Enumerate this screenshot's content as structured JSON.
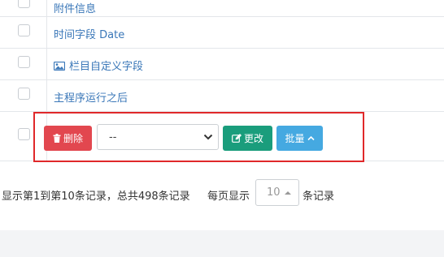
{
  "table": {
    "rows": [
      {
        "label": "附件信息"
      },
      {
        "label": "时间字段 Date"
      },
      {
        "label": "栏目自定义字段",
        "icon": "image-icon"
      },
      {
        "label": "主程序运行之后"
      }
    ]
  },
  "toolbar": {
    "delete_label": "删除",
    "delete_icon": "trash-icon",
    "select_value": "--",
    "update_label": "更改",
    "update_icon": "edit-icon",
    "batch_label": "批量",
    "batch_icon": "chevron-up-icon",
    "colors": {
      "delete": "#e2474f",
      "update": "#1a9d7c",
      "batch": "#45a9e1",
      "highlight": "#e0282a"
    }
  },
  "pagination": {
    "summary": "显示第1到第10条记录，总共498条记录",
    "per_page_prefix": "每页显示",
    "page_size": "10",
    "per_page_suffix": "条记录"
  }
}
